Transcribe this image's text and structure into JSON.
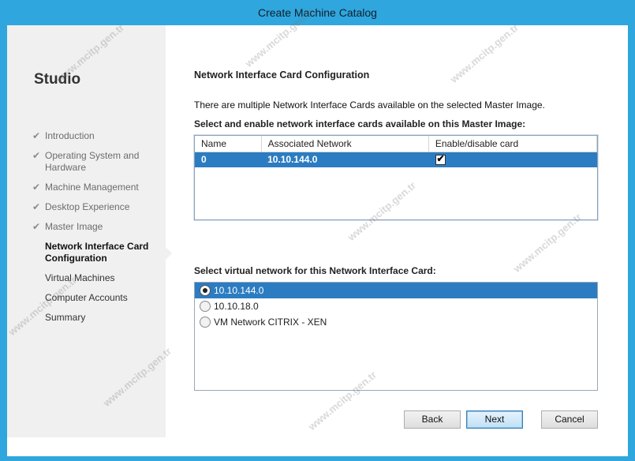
{
  "window": {
    "title": "Create Machine Catalog"
  },
  "sidebar": {
    "app_name": "Studio",
    "steps": [
      {
        "label": "Introduction",
        "done": true
      },
      {
        "label": "Operating System and Hardware",
        "done": true
      },
      {
        "label": "Machine Management",
        "done": true
      },
      {
        "label": "Desktop Experience",
        "done": true
      },
      {
        "label": "Master Image",
        "done": true
      },
      {
        "label": "Network Interface Card Configuration",
        "current": true
      },
      {
        "label": "Virtual Machines"
      },
      {
        "label": "Computer Accounts"
      },
      {
        "label": "Summary"
      }
    ]
  },
  "main": {
    "heading": "Network Interface Card Configuration",
    "description": "There are multiple Network Interface Cards available on the selected Master Image.",
    "table_label": "Select and enable network interface cards available on this Master Image:",
    "columns": [
      "Name",
      "Associated Network",
      "Enable/disable card"
    ],
    "rows": [
      {
        "name": "0",
        "network": "10.10.144.0",
        "enabled": true
      }
    ],
    "network_label": "Select virtual network for this Network Interface Card:",
    "networks": [
      {
        "label": "10.10.144.0",
        "selected": true
      },
      {
        "label": "10.10.18.0",
        "selected": false
      },
      {
        "label": "VM Network CITRIX - XEN",
        "selected": false
      }
    ]
  },
  "buttons": {
    "back": "Back",
    "next": "Next",
    "cancel": "Cancel"
  },
  "watermark": "www.mcitp.gen.tr"
}
